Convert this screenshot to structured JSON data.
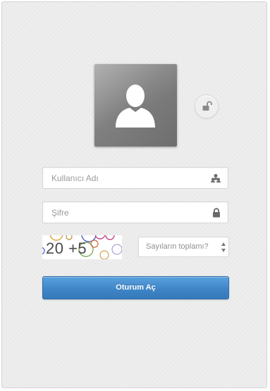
{
  "login": {
    "username_placeholder": "Kullanıcı Adı",
    "password_placeholder": "Şifre",
    "captcha_text": "20 +5",
    "sum_placeholder": "Sayıların toplamı?",
    "submit_label": "Oturum Aç"
  },
  "icons": {
    "avatar": "user-silhouette-icon",
    "lock_toggle": "unlock-icon",
    "username": "users-icon",
    "password": "lock-icon",
    "spinner": "up-down-arrows-icon"
  },
  "colors": {
    "background": "#ececec",
    "button_top": "#5aa1de",
    "button_bottom": "#3579b8",
    "avatar": "#808080"
  }
}
